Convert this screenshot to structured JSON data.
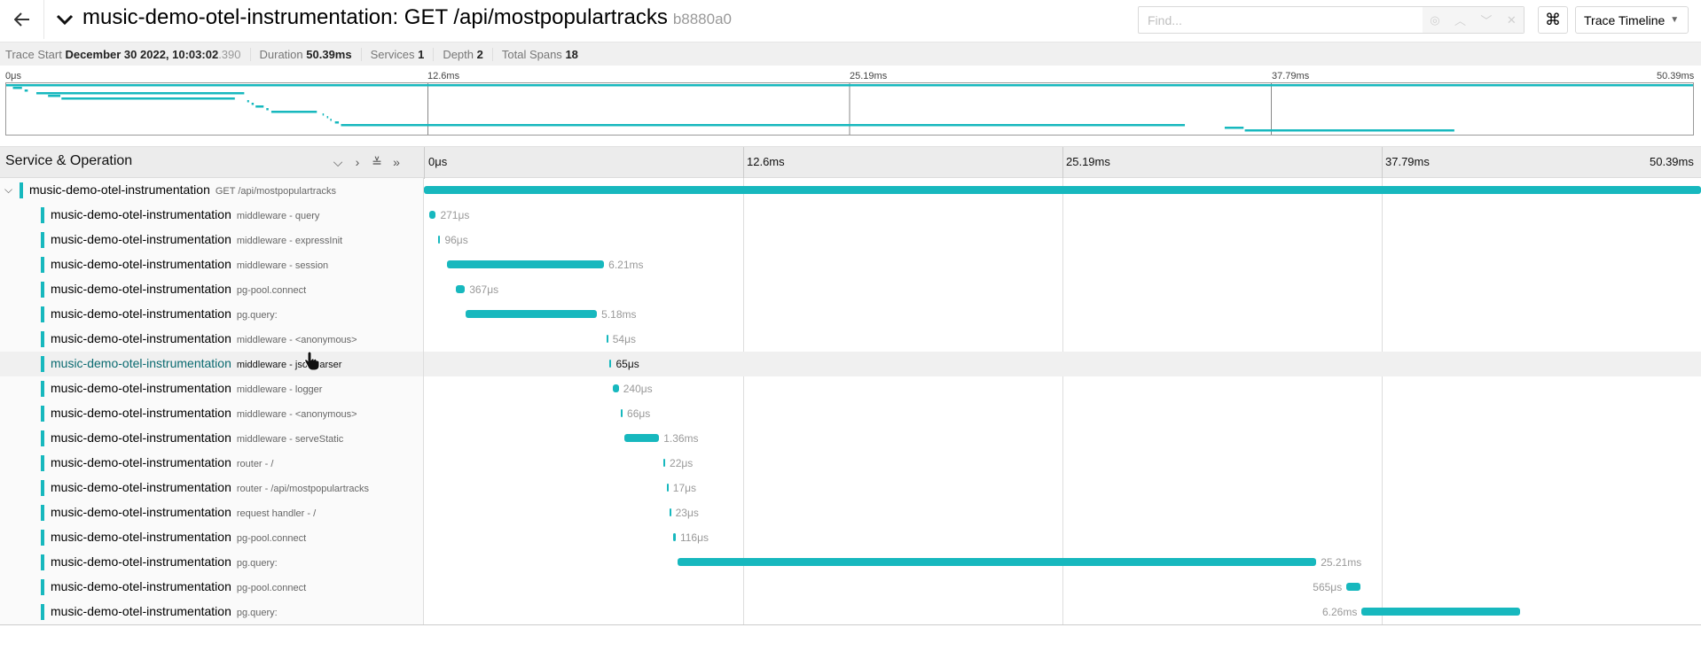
{
  "header": {
    "title": "music-demo-otel-instrumentation: GET /api/mostpopulartracks",
    "trace_id": "b8880a0",
    "find_placeholder": "Find...",
    "keyboard_icon": "⌘",
    "view_label": "Trace Timeline"
  },
  "summary": {
    "trace_start_label": "Trace Start",
    "trace_start_value": "December 30 2022, 10:03:02",
    "trace_start_ms": ".390",
    "duration_label": "Duration",
    "duration_value": "50.39ms",
    "services_label": "Services",
    "services_value": "1",
    "depth_label": "Depth",
    "depth_value": "2",
    "total_spans_label": "Total Spans",
    "total_spans_value": "18"
  },
  "minimap_ticks": [
    "0μs",
    "12.6ms",
    "25.19ms",
    "37.79ms",
    "50.39ms"
  ],
  "timeline": {
    "column_title": "Service & Operation",
    "ticks": [
      "0μs",
      "12.6ms",
      "25.19ms",
      "37.79ms",
      "50.39ms"
    ],
    "total_ms": 50.39
  },
  "spans": [
    {
      "service": "music-demo-otel-instrumentation",
      "operation": "GET /api/mostpopulartracks",
      "start_ms": 0,
      "duration_ms": 50.39,
      "duration_label": "",
      "depth": 0
    },
    {
      "service": "music-demo-otel-instrumentation",
      "operation": "middleware - query",
      "start_ms": 0.2,
      "duration_ms": 0.271,
      "duration_label": "271μs",
      "depth": 1
    },
    {
      "service": "music-demo-otel-instrumentation",
      "operation": "middleware - expressInit",
      "start_ms": 0.55,
      "duration_ms": 0.096,
      "duration_label": "96μs",
      "depth": 1
    },
    {
      "service": "music-demo-otel-instrumentation",
      "operation": "middleware - session",
      "start_ms": 0.9,
      "duration_ms": 6.21,
      "duration_label": "6.21ms",
      "depth": 1
    },
    {
      "service": "music-demo-otel-instrumentation",
      "operation": "pg-pool.connect",
      "start_ms": 1.25,
      "duration_ms": 0.367,
      "duration_label": "367μs",
      "depth": 1
    },
    {
      "service": "music-demo-otel-instrumentation",
      "operation": "pg.query:",
      "start_ms": 1.65,
      "duration_ms": 5.18,
      "duration_label": "5.18ms",
      "depth": 1
    },
    {
      "service": "music-demo-otel-instrumentation",
      "operation": "middleware - <anonymous>",
      "start_ms": 7.2,
      "duration_ms": 0.054,
      "duration_label": "54μs",
      "depth": 1
    },
    {
      "service": "music-demo-otel-instrumentation",
      "operation": "middleware - jsonParser",
      "start_ms": 7.33,
      "duration_ms": 0.065,
      "duration_label": "65μs",
      "depth": 1,
      "hover": true
    },
    {
      "service": "music-demo-otel-instrumentation",
      "operation": "middleware - logger",
      "start_ms": 7.45,
      "duration_ms": 0.24,
      "duration_label": "240μs",
      "depth": 1
    },
    {
      "service": "music-demo-otel-instrumentation",
      "operation": "middleware - <anonymous>",
      "start_ms": 7.77,
      "duration_ms": 0.066,
      "duration_label": "66μs",
      "depth": 1
    },
    {
      "service": "music-demo-otel-instrumentation",
      "operation": "middleware - serveStatic",
      "start_ms": 7.92,
      "duration_ms": 1.36,
      "duration_label": "1.36ms",
      "depth": 1
    },
    {
      "service": "music-demo-otel-instrumentation",
      "operation": "router - /",
      "start_ms": 9.45,
      "duration_ms": 0.022,
      "duration_label": "22μs",
      "depth": 1
    },
    {
      "service": "music-demo-otel-instrumentation",
      "operation": "router - /api/mostpopulartracks",
      "start_ms": 9.58,
      "duration_ms": 0.017,
      "duration_label": "17μs",
      "depth": 1
    },
    {
      "service": "music-demo-otel-instrumentation",
      "operation": "request handler - /",
      "start_ms": 9.68,
      "duration_ms": 0.023,
      "duration_label": "23μs",
      "depth": 1
    },
    {
      "service": "music-demo-otel-instrumentation",
      "operation": "pg-pool.connect",
      "start_ms": 9.82,
      "duration_ms": 0.116,
      "duration_label": "116μs",
      "depth": 1
    },
    {
      "service": "music-demo-otel-instrumentation",
      "operation": "pg.query:",
      "start_ms": 10.0,
      "duration_ms": 25.21,
      "duration_label": "25.21ms",
      "depth": 1
    },
    {
      "service": "music-demo-otel-instrumentation",
      "operation": "pg-pool.connect",
      "start_ms": 36.4,
      "duration_ms": 0.565,
      "duration_label": "565μs",
      "depth": 1,
      "label_left": true
    },
    {
      "service": "music-demo-otel-instrumentation",
      "operation": "pg.query:",
      "start_ms": 37.0,
      "duration_ms": 6.26,
      "duration_label": "6.26ms",
      "depth": 1,
      "label_left": true
    }
  ],
  "colors": {
    "span": "#17b8be",
    "grid": "#dddddd"
  },
  "icons": {
    "back": "back-arrow-icon",
    "collapse": "chevron-down-icon",
    "keyboard": "command-icon",
    "row_expand": "chevron-down-icon"
  }
}
